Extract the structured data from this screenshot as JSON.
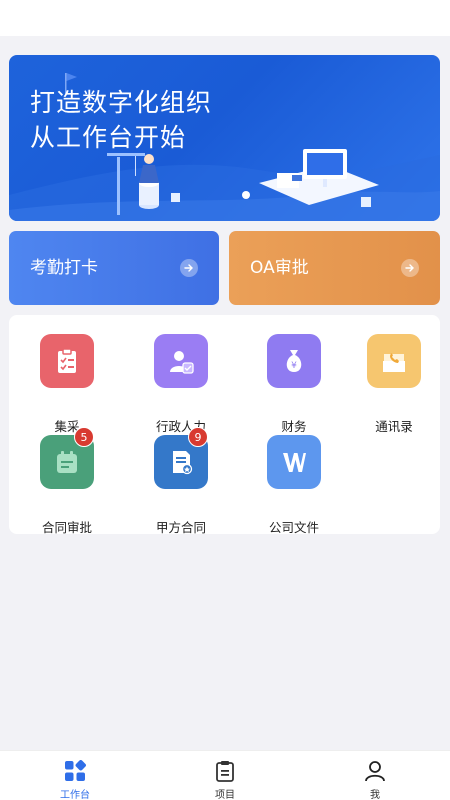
{
  "banner": {
    "line1": "打造数字化组织",
    "line2": "从工作台开始"
  },
  "quick_actions": [
    {
      "label": "考勤打卡",
      "icon": "arrow-right-icon",
      "color": "#4a7eec"
    },
    {
      "label": "OA审批",
      "icon": "arrow-right-icon",
      "color": "#e6974e"
    }
  ],
  "apps": [
    {
      "label": "集采",
      "icon": "clipboard-check-icon",
      "color": "#e8646b"
    },
    {
      "label": "行政人力",
      "icon": "person-badge-icon",
      "color": "#9a7df3"
    },
    {
      "label": "财务",
      "icon": "money-bag-icon",
      "color": "#8f7bf1"
    },
    {
      "label": "通讯录",
      "icon": "contact-box-icon",
      "color": "#f6c66f"
    },
    {
      "label": "合同审批",
      "icon": "contract-approval-icon",
      "color": "#4aa07a",
      "badge": "5"
    },
    {
      "label": "甲方合同",
      "icon": "certificate-document-icon",
      "color": "#3478c9",
      "badge": "9"
    },
    {
      "label": "公司文件",
      "icon": "word-file-icon",
      "color": "#5d97ee"
    }
  ],
  "tabs": [
    {
      "label": "工作台",
      "icon": "grid-apps-icon",
      "active": true
    },
    {
      "label": "项目",
      "icon": "clipboard-icon",
      "active": false
    },
    {
      "label": "我",
      "icon": "person-icon",
      "active": false
    }
  ],
  "colors": {
    "accent": "#2f6ee8",
    "background": "#f2f2f6",
    "badge": "#d83a30"
  }
}
